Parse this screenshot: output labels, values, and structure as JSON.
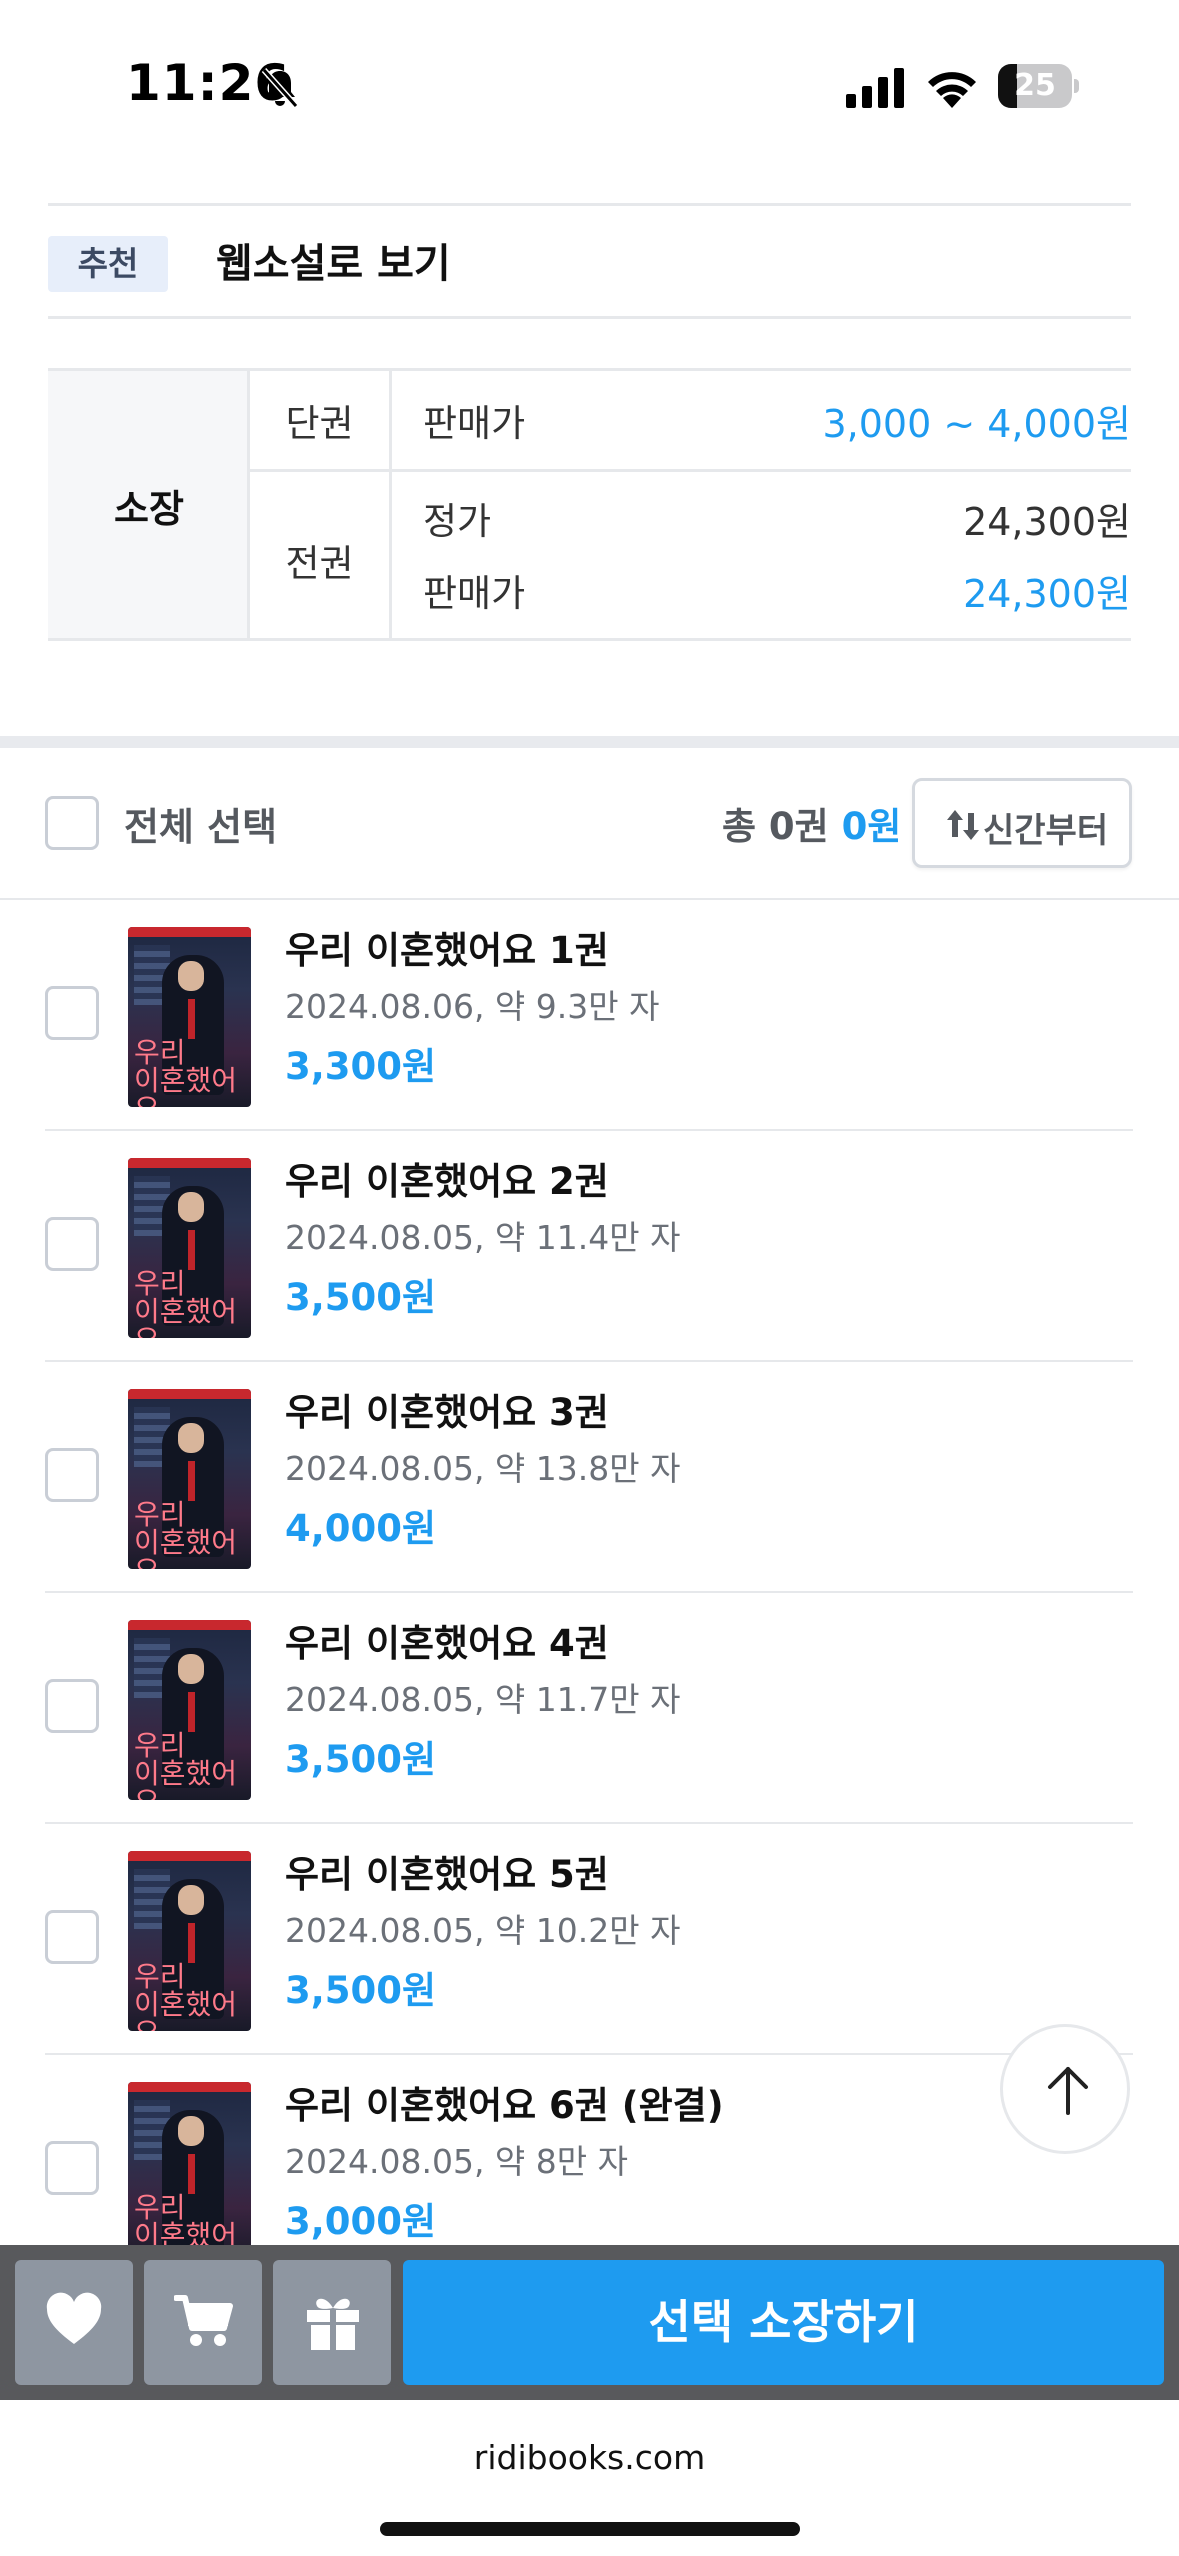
{
  "status_bar": {
    "time": "11:26",
    "battery": "25",
    "battery_level": 0.25
  },
  "recommend": {
    "tag": "추천",
    "text": "웹소설로 보기"
  },
  "price_table": {
    "own_label": "소장",
    "single": {
      "label": "단권",
      "key": "판매가",
      "value": "3,000 ~ 4,000원"
    },
    "all": {
      "label": "전권",
      "list_key": "정가",
      "list_value": "24,300원",
      "sale_key": "판매가",
      "sale_value": "24,300원"
    }
  },
  "select_bar": {
    "select_all": "전체 선택",
    "total_prefix": "총 0권",
    "total_amount": "0원",
    "sort_label": "신간부터"
  },
  "cover": {
    "title_line1": "우리",
    "title_line2": "이혼했어요"
  },
  "books": [
    {
      "title": "우리 이혼했어요 1권",
      "meta": "2024.08.06, 약 9.3만 자",
      "price": "3,300원"
    },
    {
      "title": "우리 이혼했어요 2권",
      "meta": "2024.08.05, 약 11.4만 자",
      "price": "3,500원"
    },
    {
      "title": "우리 이혼했어요 3권",
      "meta": "2024.08.05, 약 13.8만 자",
      "price": "4,000원"
    },
    {
      "title": "우리 이혼했어요 4권",
      "meta": "2024.08.05, 약 11.7만 자",
      "price": "3,500원"
    },
    {
      "title": "우리 이혼했어요 5권",
      "meta": "2024.08.05, 약 10.2만 자",
      "price": "3,500원"
    },
    {
      "title": "우리 이혼했어요 6권 (완결)",
      "meta": "2024.08.05, 약 8만 자",
      "price": "3,000원"
    }
  ],
  "action_bar": {
    "buy_label": "선택 소장하기"
  },
  "browser": {
    "url": "ridibooks.com"
  }
}
